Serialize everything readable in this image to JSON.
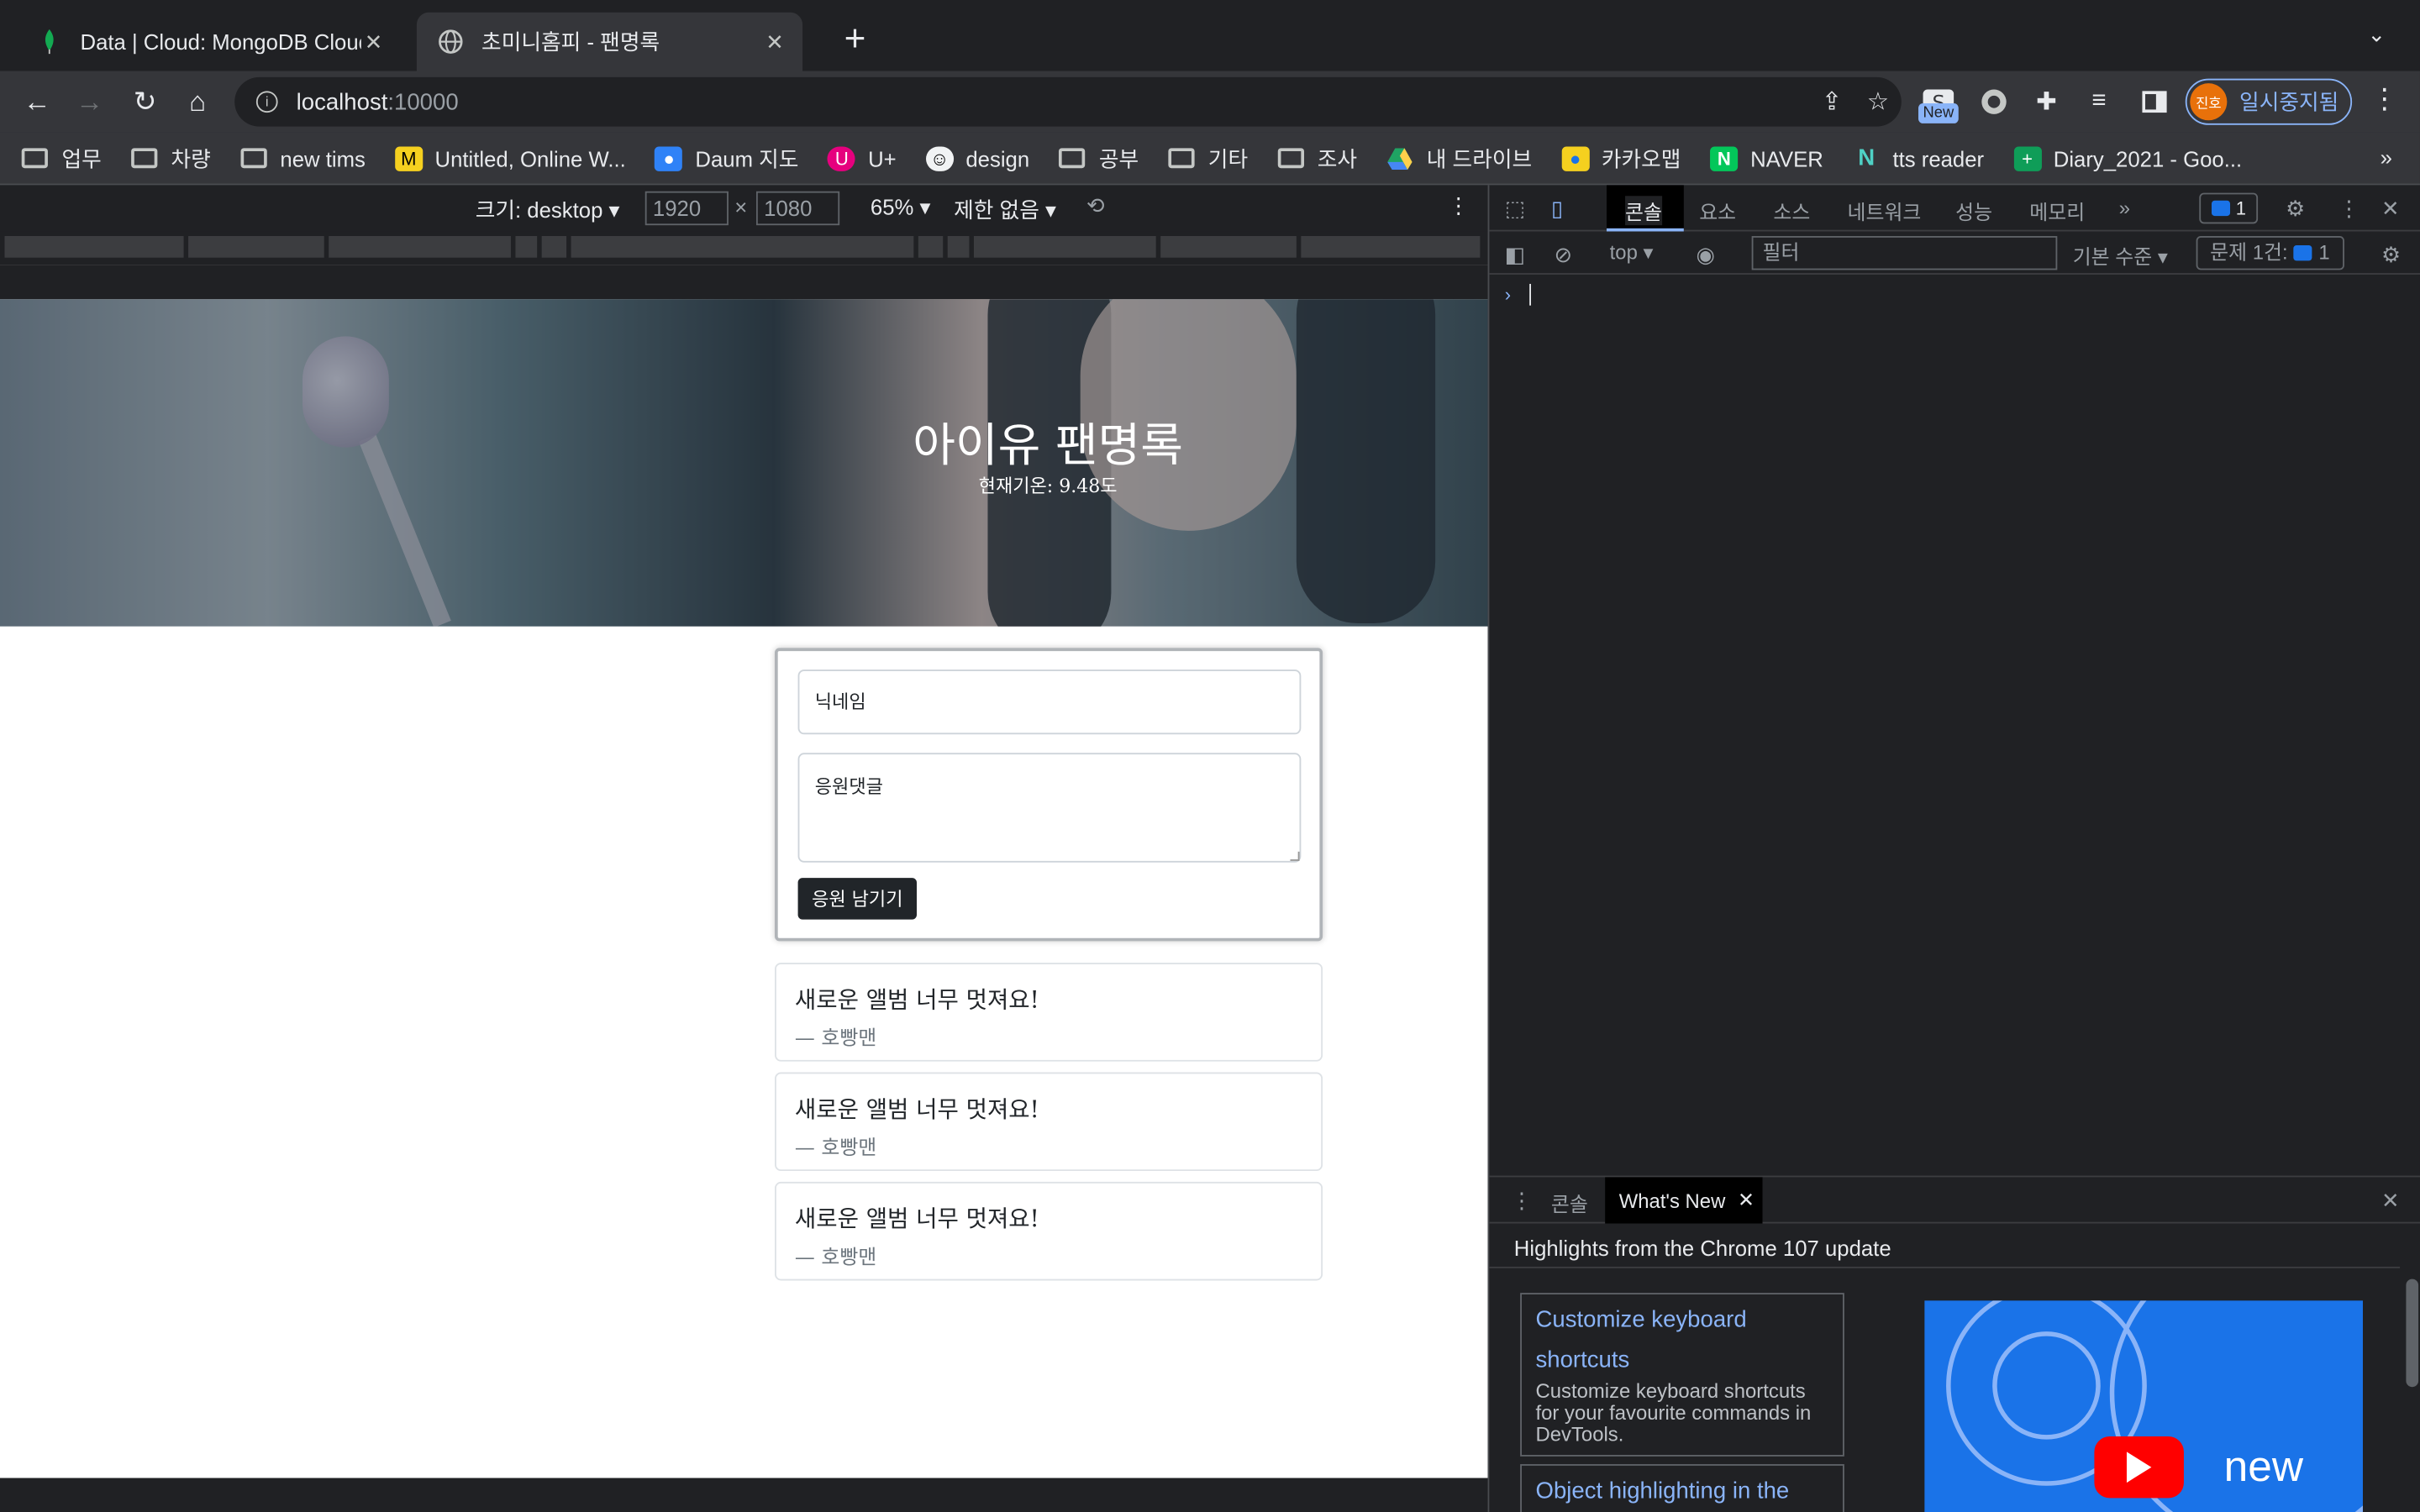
{
  "browser": {
    "tabs": [
      {
        "title": "Data | Cloud: MongoDB Cloud",
        "active": false
      },
      {
        "title": "초미니홈피 - 팬명록",
        "active": true
      }
    ],
    "url_host": "localhost",
    "url_port": ":10000",
    "new_badge": "New",
    "profile_initials": "진호",
    "profile_label": "일시중지됨",
    "bookmarks": [
      "업무",
      "차량",
      "new tims",
      "Untitled, Online W...",
      "Daum 지도",
      "U+",
      "design",
      "공부",
      "기타",
      "조사",
      "내 드라이브",
      "카카오맵",
      "NAVER",
      "tts reader",
      "Diary_2021 - Goo..."
    ],
    "bookmarks_more": "»"
  },
  "device_toolbar": {
    "size_label": "크기: desktop",
    "width": "1920",
    "height": "1080",
    "times": "×",
    "zoom": "65%",
    "throttle": "제한 없음"
  },
  "page": {
    "title": "아이유 팬명록",
    "temperature": "현재기온: 9.48도",
    "form": {
      "nickname_placeholder": "닉네임",
      "comment_placeholder": "응원댓글",
      "submit_label": "응원 남기기"
    },
    "comments": [
      {
        "message": "새로운 앨범 너무 멋져요!",
        "author": "— 호빵맨"
      },
      {
        "message": "새로운 앨범 너무 멋져요!",
        "author": "— 호빵맨"
      },
      {
        "message": "새로운 앨범 너무 멋져요!",
        "author": "— 호빵맨"
      }
    ]
  },
  "devtools": {
    "tabs": [
      "콘솔",
      "요소",
      "소스",
      "네트워크",
      "성능",
      "메모리"
    ],
    "more": "»",
    "issue_count": "1",
    "console_context": "top",
    "filter_placeholder": "필터",
    "log_level": "기본 수준",
    "issues_label": "문제 1건:",
    "issues_count": "1",
    "prompt": "›",
    "drawer": {
      "tab_console": "콘솔",
      "tab_whats_new": "What's New",
      "headline": "Highlights from the Chrome 107 update",
      "cards": [
        {
          "title": "Customize keyboard shortcuts",
          "desc": "Customize keyboard shortcuts for your favourite commands in DevTools."
        },
        {
          "title": "Object highlighting in the",
          "desc": ""
        }
      ],
      "video_text": "new"
    }
  },
  "colors": {
    "chrome_bg": "#202124",
    "toolbar_bg": "#35363a",
    "accent": "#8ab4f8",
    "button_dark": "#212529"
  }
}
